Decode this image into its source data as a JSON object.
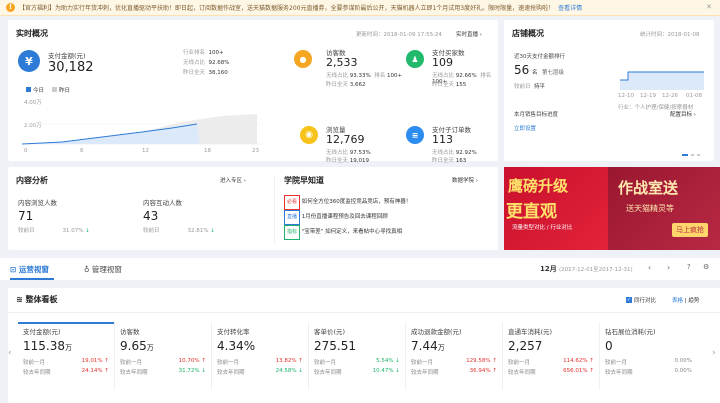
{
  "notice": {
    "text": "【官方福利】为助力实行年货冲刺，优化直播驱动平扶助！即日起，订阅数据作战室，送天猫数据服务200元直播券，全要参谋阶最后公开，天猫机器人立即1个月试用3度好礼。限时限量，速速抢购啦！",
    "link": "查看详情"
  },
  "realtime": {
    "title": "实时概况",
    "update_time": "更新时间：2018-01-09 17:55:24",
    "detail_link": "实时直播 ›",
    "pay_label": "支付金额(元)",
    "pay_value": "30,182",
    "pay_stats": [
      {
        "label": "行业排名",
        "value": "100+"
      },
      {
        "label": "无线占比",
        "value": "92.68%"
      },
      {
        "label": "昨日全天",
        "value": "38,160"
      }
    ],
    "legend_today": "今日",
    "legend_yesterday": "昨日",
    "y_labels": [
      "4.00万",
      "2.00万"
    ],
    "x_labels": [
      "0",
      "6",
      "12",
      "18",
      "23"
    ],
    "metrics": [
      {
        "label": "访客数",
        "value": "2,533",
        "r1k": "无线占比",
        "r1v": "93.33%",
        "r2k": "昨日全天",
        "r2v": "3,662",
        "extra_k": "排名",
        "extra_v": "100+",
        "color": "#f5a623",
        "icon": "visitors-icon"
      },
      {
        "label": "支付买家数",
        "value": "109",
        "r1k": "无线占比",
        "r1v": "92.66%",
        "r2k": "昨日全天",
        "r2v": "155",
        "extra_k": "排名",
        "extra_v": "100+",
        "color": "#21b96b",
        "icon": "buyers-icon"
      },
      {
        "label": "浏览量",
        "value": "12,769",
        "r1k": "无线占比",
        "r1v": "97.53%",
        "r2k": "昨日全天",
        "r2v": "19,019",
        "extra_k": "",
        "extra_v": "",
        "color": "#f7c21a",
        "icon": "eye-icon"
      },
      {
        "label": "支付子订单数",
        "value": "113",
        "r1k": "无线占比",
        "r1v": "92.92%",
        "r2k": "昨日全天",
        "r2v": "163",
        "extra_k": "",
        "extra_v": "",
        "color": "#2d8cf0",
        "icon": "orders-icon"
      }
    ]
  },
  "store": {
    "title": "店铺概况",
    "stat_time": "统计时间：2018-01-08",
    "rank_label": "近30天支付金额排行",
    "rank_value": "56",
    "rank_unit": "名",
    "rank_level": "第七层级",
    "prev_label": "较前日",
    "prev_value": "持平",
    "x_labels": [
      "12-10",
      "12-19",
      "12-26",
      "01-08"
    ],
    "industry_text": "行业：个人护理/保健/按摩器材",
    "target_title": "本月销售目标进度",
    "target_link": "配置目标 ›",
    "setup_link": "立即设置"
  },
  "content": {
    "title": "内容分析",
    "link": "进入专区 ›",
    "items": [
      {
        "label": "内容浏览人数",
        "value": "71",
        "cmp": "较前日",
        "pct": "31.07%"
      },
      {
        "label": "内容互动人数",
        "value": "43",
        "cmp": "较前日",
        "pct": "32.81%"
      }
    ]
  },
  "academy": {
    "title": "学院早知道",
    "link": "数据学院 ›",
    "items": [
      {
        "tag": "必看",
        "tag_color": "#e5322d",
        "text": "如何全方位360度监控竞品竞店，预有神器！"
      },
      {
        "tag": "直播",
        "tag_color": "#2d7bd6",
        "text": "1月份直播课程预告及回去课程回顾"
      },
      {
        "tag": "指标",
        "tag_color": "#1eb36b",
        "text": "\"宝带差\" 如何定义，来看帖中心寻找真相"
      }
    ]
  },
  "banner": {
    "left_line1": "鹰磅升级",
    "left_line2": "更直观",
    "left_line3": "流量类型对比 / 行业对比",
    "right_line1": "作战室送",
    "right_line2": "送天猫精灵等",
    "right_button": "马上疯抢"
  },
  "tabs": {
    "active": "运营视窗",
    "other": "管理视窗",
    "period_label": "12月",
    "period_range": "(2017-12-01至2017-12-31)"
  },
  "board": {
    "title": "整体看板",
    "compare_label": "同行对比",
    "view_table": "表格",
    "view_trend": "趋势",
    "cmp1": "较前一月",
    "cmp2": "较去年同期",
    "kpis": [
      {
        "label": "支付金额(元)",
        "value": "115.38",
        "unit": "万",
        "p1": "19.01%",
        "d1": "up",
        "p2": "24.14%",
        "d2": "up"
      },
      {
        "label": "访客数",
        "value": "9.65",
        "unit": "万",
        "p1": "10.70%",
        "d1": "up",
        "p2": "31.72%",
        "d2": "down"
      },
      {
        "label": "支付转化率",
        "value": "4.34%",
        "unit": "",
        "p1": "13.82%",
        "d1": "up",
        "p2": "24.58%",
        "d2": "down"
      },
      {
        "label": "客单价(元)",
        "value": "275.51",
        "unit": "",
        "p1": "5.54%",
        "d1": "down",
        "p2": "10.47%",
        "d2": "down"
      },
      {
        "label": "成功退款金额(元)",
        "value": "7.44",
        "unit": "万",
        "p1": "129.58%",
        "d1": "up",
        "p2": "36.94%",
        "d2": "up"
      },
      {
        "label": "直通车消耗(元)",
        "value": "2,257",
        "unit": "",
        "p1": "114.62%",
        "d1": "up",
        "p2": "656.01%",
        "d2": "up"
      },
      {
        "label": "钻石展位消耗(元)",
        "value": "0",
        "unit": "",
        "p1": "0.00%",
        "d1": "",
        "p2": "0.00%",
        "d2": ""
      }
    ]
  },
  "colors": {
    "accent": "#2d7bd6",
    "up": "#e5322d",
    "down": "#1eb36b"
  }
}
